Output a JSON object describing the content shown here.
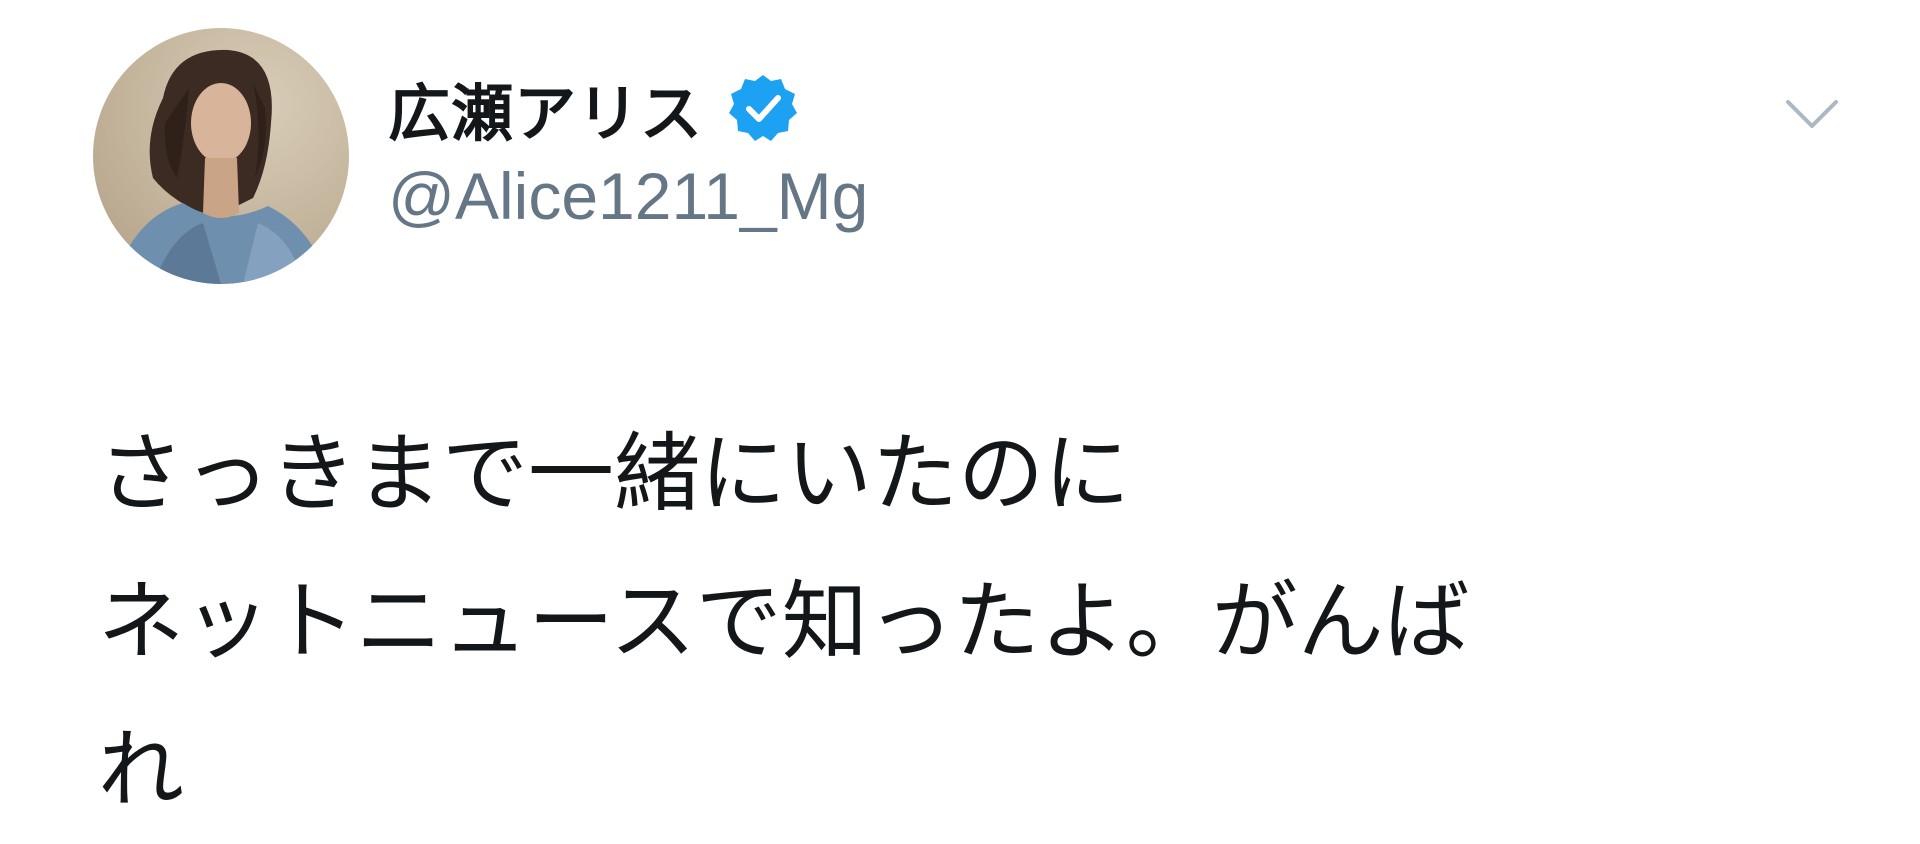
{
  "tweet": {
    "author": {
      "display_name": "広瀬アリス",
      "handle": "@Alice1211_Mg",
      "verified": true
    },
    "text_lines": [
      "さっきまで一緒にいたのに",
      "ネットニュースで知ったよ。がんば",
      "れ"
    ]
  },
  "colors": {
    "name": "#14171a",
    "handle": "#657786",
    "verified": "#1da1f2",
    "chevron": "#aab8c2",
    "text": "#14171a"
  },
  "icons": {
    "verified": "verified-badge-icon",
    "more": "chevron-down-icon"
  }
}
